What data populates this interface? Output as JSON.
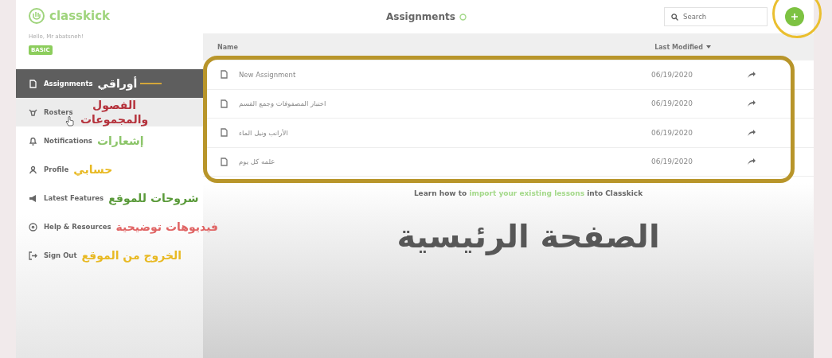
{
  "sidebar": {
    "logo": "classkick",
    "greeting": "Hello, Mr abatsneh!",
    "plan_badge": "BASIC",
    "items": [
      {
        "label": "Assignments",
        "selected": true,
        "hovered": false,
        "note": {
          "text": "أوراقي",
          "color": "#ffffff",
          "leader": true
        }
      },
      {
        "label": "Rosters",
        "selected": false,
        "hovered": true,
        "note": {
          "text": "الفصول والمجموعات",
          "color": "#b5323c"
        }
      },
      {
        "label": "Notifications",
        "selected": false,
        "hovered": false,
        "note": {
          "text": "إشعارات",
          "color": "#8cc56a"
        }
      },
      {
        "label": "Profile",
        "selected": false,
        "hovered": false,
        "note": {
          "text": "حسابي",
          "color": "#e8b923"
        }
      },
      {
        "label": "Latest Features",
        "selected": false,
        "hovered": false,
        "note": {
          "text": "شروحات للموقع",
          "color": "#5a9a3a"
        }
      },
      {
        "label": "Help & Resources",
        "selected": false,
        "hovered": false,
        "note": {
          "text": "فيديوهات توضيحية",
          "color": "#e06464"
        }
      },
      {
        "label": "Sign Out",
        "selected": false,
        "hovered": false,
        "note": {
          "text": "الخروج من الموقع",
          "color": "#e8b923"
        }
      }
    ]
  },
  "header": {
    "title": "Assignments",
    "search": {
      "placeholder": "Search"
    }
  },
  "table": {
    "name_header": "Name",
    "date_header": "Last Modified",
    "rows": [
      {
        "name": "New Assignment",
        "modified": "06/19/2020"
      },
      {
        "name": "اختبار المصفوفات وجمع القسم",
        "modified": "06/19/2020"
      },
      {
        "name": "الأرانب ونيل الماء",
        "modified": "06/19/2020"
      },
      {
        "name": "علمه كل يوم",
        "modified": "06/19/2020"
      }
    ]
  },
  "footer": {
    "before": "Learn how to",
    "link": "import your existing lessons",
    "after": "into Classkick"
  },
  "overlay_title": "الصفحة الرئيسية"
}
